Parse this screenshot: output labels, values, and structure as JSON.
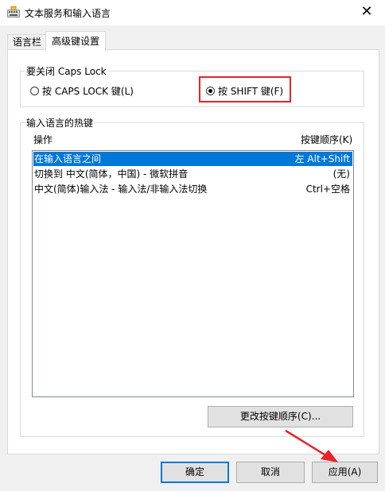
{
  "window": {
    "title": "文本服务和输入语言",
    "close_glyph": "✕"
  },
  "tabs": [
    {
      "label": "语言栏"
    },
    {
      "label": "高级键设置"
    }
  ],
  "caps_lock_group": {
    "title": "要关闭 Caps Lock",
    "options": [
      {
        "label": "按 CAPS LOCK 键(L)",
        "checked": false
      },
      {
        "label": "按 SHIFT 键(F)",
        "checked": true
      }
    ]
  },
  "hotkey_group": {
    "title": "输入语言的热键",
    "columns": {
      "action": "操作",
      "key_sequence": "按键顺序(K)"
    },
    "rows": [
      {
        "action": "在输入语言之间",
        "keys": "左 Alt+Shift",
        "selected": true
      },
      {
        "action": "切换到 中文(简体，中国) - 微软拼音",
        "keys": "(无)",
        "selected": false
      },
      {
        "action": "中文(简体)输入法 - 输入法/非输入法切换",
        "keys": "Ctrl+空格",
        "selected": false
      }
    ],
    "change_button": "更改按键顺序(C)..."
  },
  "buttons": {
    "ok": "确定",
    "cancel": "取消",
    "apply": "应用(A)"
  },
  "colors": {
    "selection": "#0078d7",
    "annotation_red": "#e8232b"
  }
}
